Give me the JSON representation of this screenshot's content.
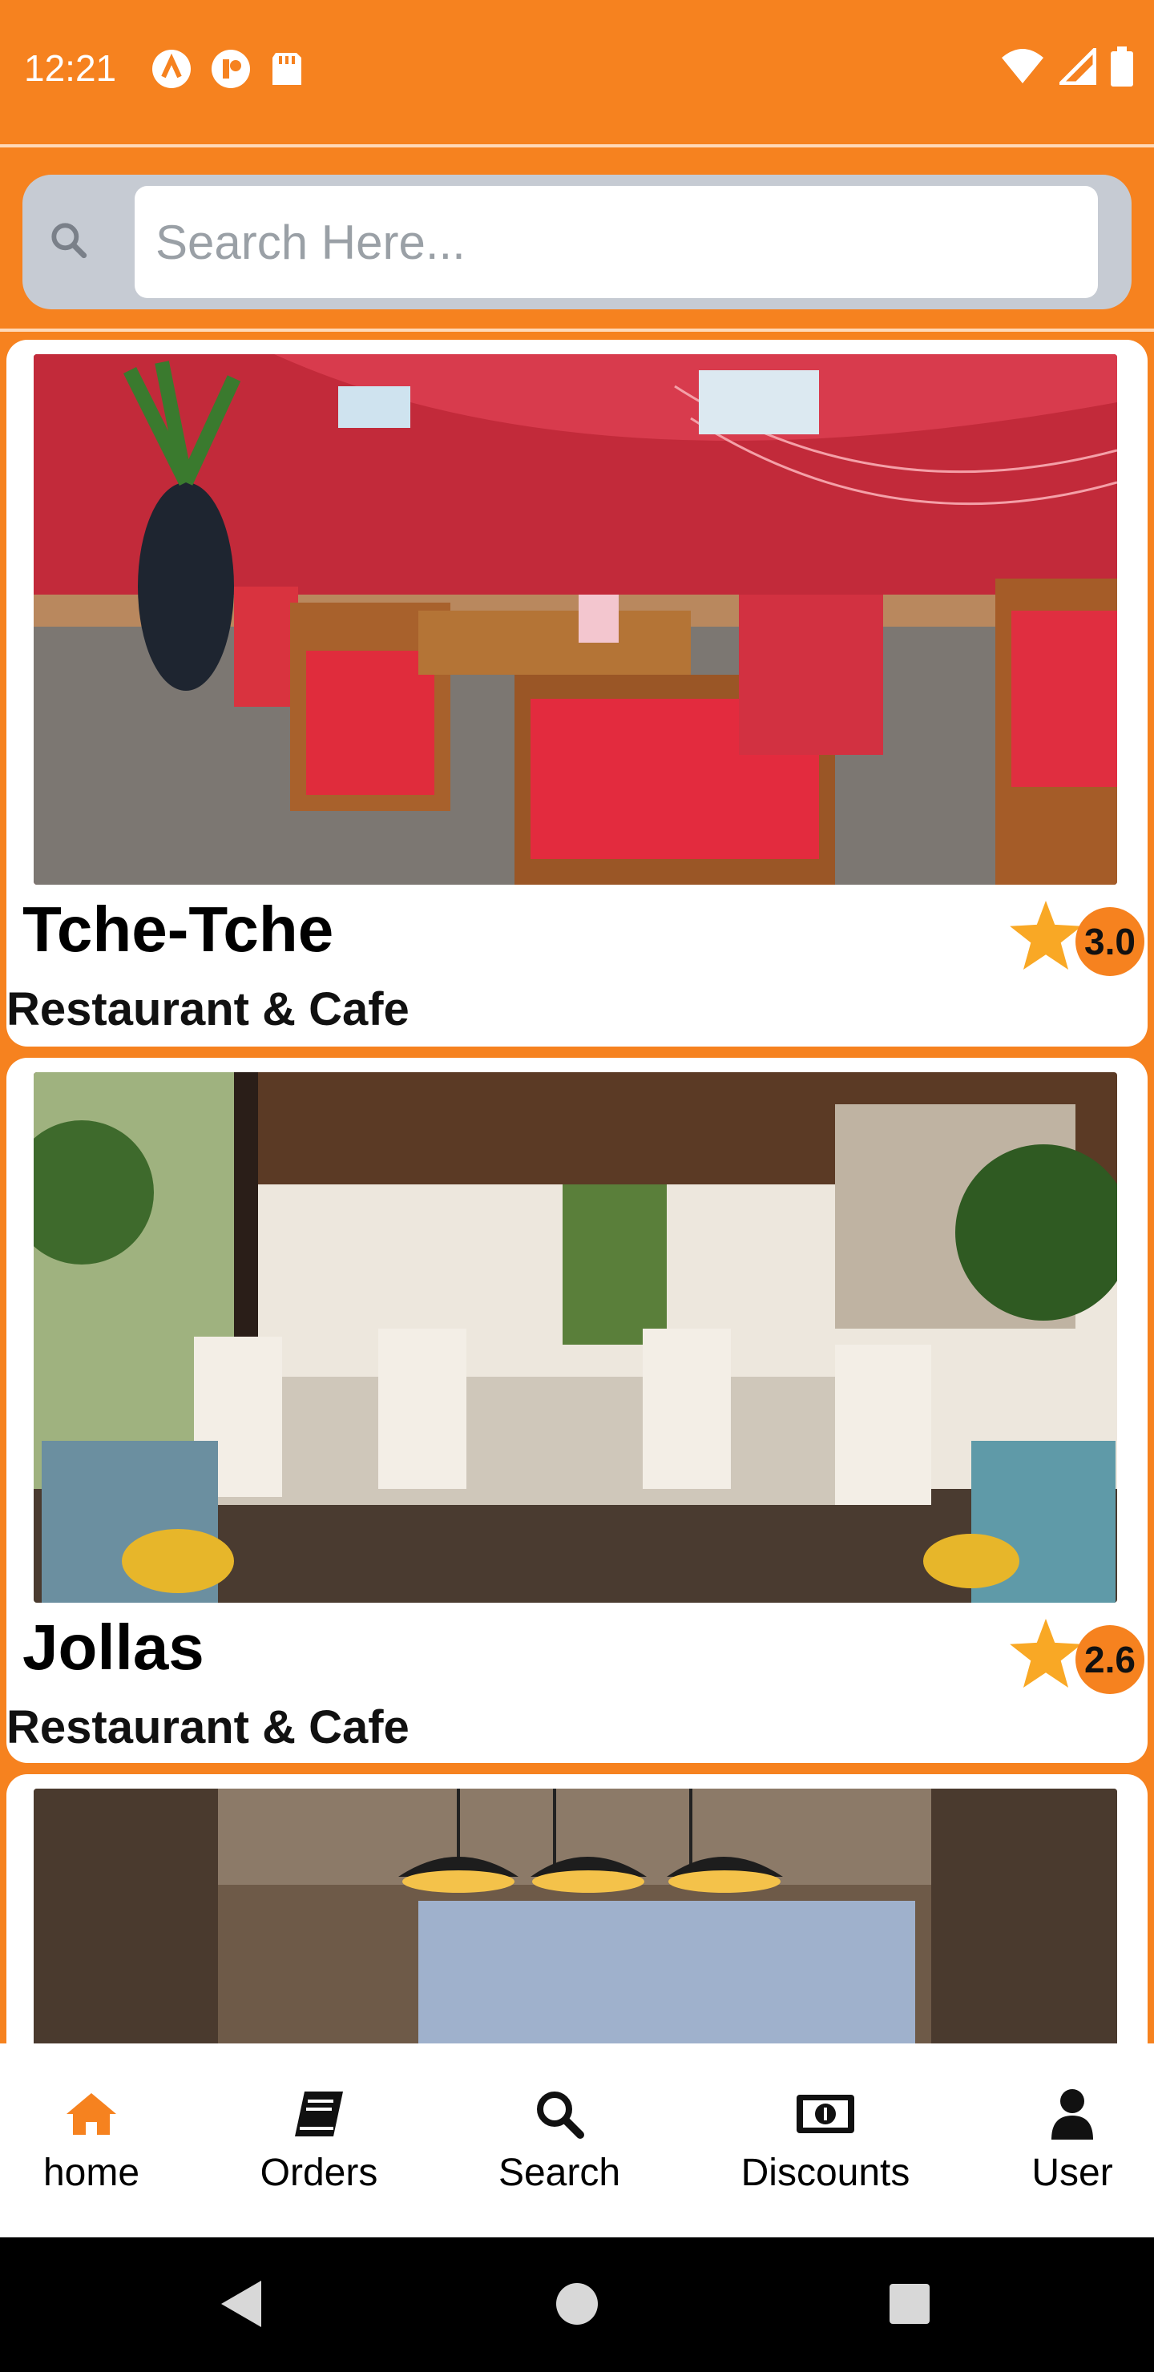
{
  "status_bar": {
    "time": "12:21"
  },
  "search": {
    "placeholder": "Search Here..."
  },
  "restaurants": [
    {
      "name": "Tche-Tche",
      "category": "Restaurant & Cafe",
      "rating": "3.0",
      "image": "red-dining-room-photo"
    },
    {
      "name": "Jollas",
      "category": "Restaurant & Cafe",
      "rating": "2.6",
      "image": "white-dining-room-photo"
    },
    {
      "name": "",
      "category": "",
      "rating": "",
      "image": "pendant-lamps-interior-photo"
    }
  ],
  "bottom_nav": {
    "items": [
      {
        "label": "home",
        "icon": "home-icon",
        "active": true
      },
      {
        "label": "Orders",
        "icon": "book-icon"
      },
      {
        "label": "Search",
        "icon": "search-icon"
      },
      {
        "label": "Discounts",
        "icon": "money-bill-icon"
      },
      {
        "label": "User",
        "icon": "user-icon"
      }
    ]
  },
  "colors": {
    "primary": "#F6821F",
    "star": "#F9A825",
    "card": "#FFFFFF"
  }
}
